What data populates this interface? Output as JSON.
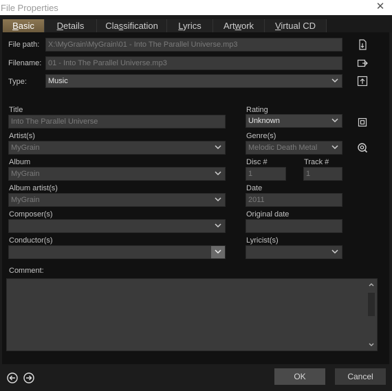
{
  "window": {
    "title": "File Properties",
    "close_glyph": "✕"
  },
  "tabs": [
    {
      "pre": "",
      "u": "B",
      "post": "asic"
    },
    {
      "pre": "",
      "u": "D",
      "post": "etails"
    },
    {
      "pre": "Cla",
      "u": "s",
      "post": "sification"
    },
    {
      "pre": "",
      "u": "L",
      "post": "yrics"
    },
    {
      "pre": "Art",
      "u": "w",
      "post": "ork"
    },
    {
      "pre": "",
      "u": "V",
      "post": "irtual CD"
    }
  ],
  "file": {
    "path_label": "File path:",
    "path_value": "X:\\MyGrain\\MyGrain\\01 - Into The Parallel Universe.mp3",
    "name_label": "Filename:",
    "name_value": "01 - Into The Parallel Universe.mp3",
    "type_label": "Type:",
    "type_value": "Music"
  },
  "tags": {
    "title_label": "Title",
    "title_value": "Into The Parallel Universe",
    "artist_label": "Artist(s)",
    "artist_value": "MyGrain",
    "album_label": "Album",
    "album_value": "MyGrain",
    "album_artist_label": "Album artist(s)",
    "album_artist_value": "MyGrain",
    "composer_label": "Composer(s)",
    "composer_value": "",
    "conductor_label": "Conductor(s)",
    "conductor_value": "",
    "rating_label": "Rating",
    "rating_value": "Unknown",
    "genre_label": "Genre(s)",
    "genre_value": "Melodic Death Metal",
    "disc_label": "Disc #",
    "disc_value": "1",
    "track_label": "Track #",
    "track_value": "1",
    "date_label": "Date",
    "date_value": "2011",
    "original_date_label": "Original date",
    "original_date_value": "",
    "lyricist_label": "Lyricist(s)",
    "lyricist_value": "",
    "comment_label": "Comment:",
    "comment_value": ""
  },
  "buttons": {
    "ok": "OK",
    "cancel": "Cancel"
  },
  "icons": {
    "path": "file-locate-icon",
    "rename": "rename-file-icon",
    "type": "export-icon",
    "rating": "copy-icon",
    "genre": "search-web-icon",
    "back": "arrow-left-circle-icon",
    "forward": "arrow-right-circle-icon"
  },
  "colors": {
    "accent_tab": "#8b7652",
    "background": "#111111",
    "field": "#3a3a3a"
  }
}
